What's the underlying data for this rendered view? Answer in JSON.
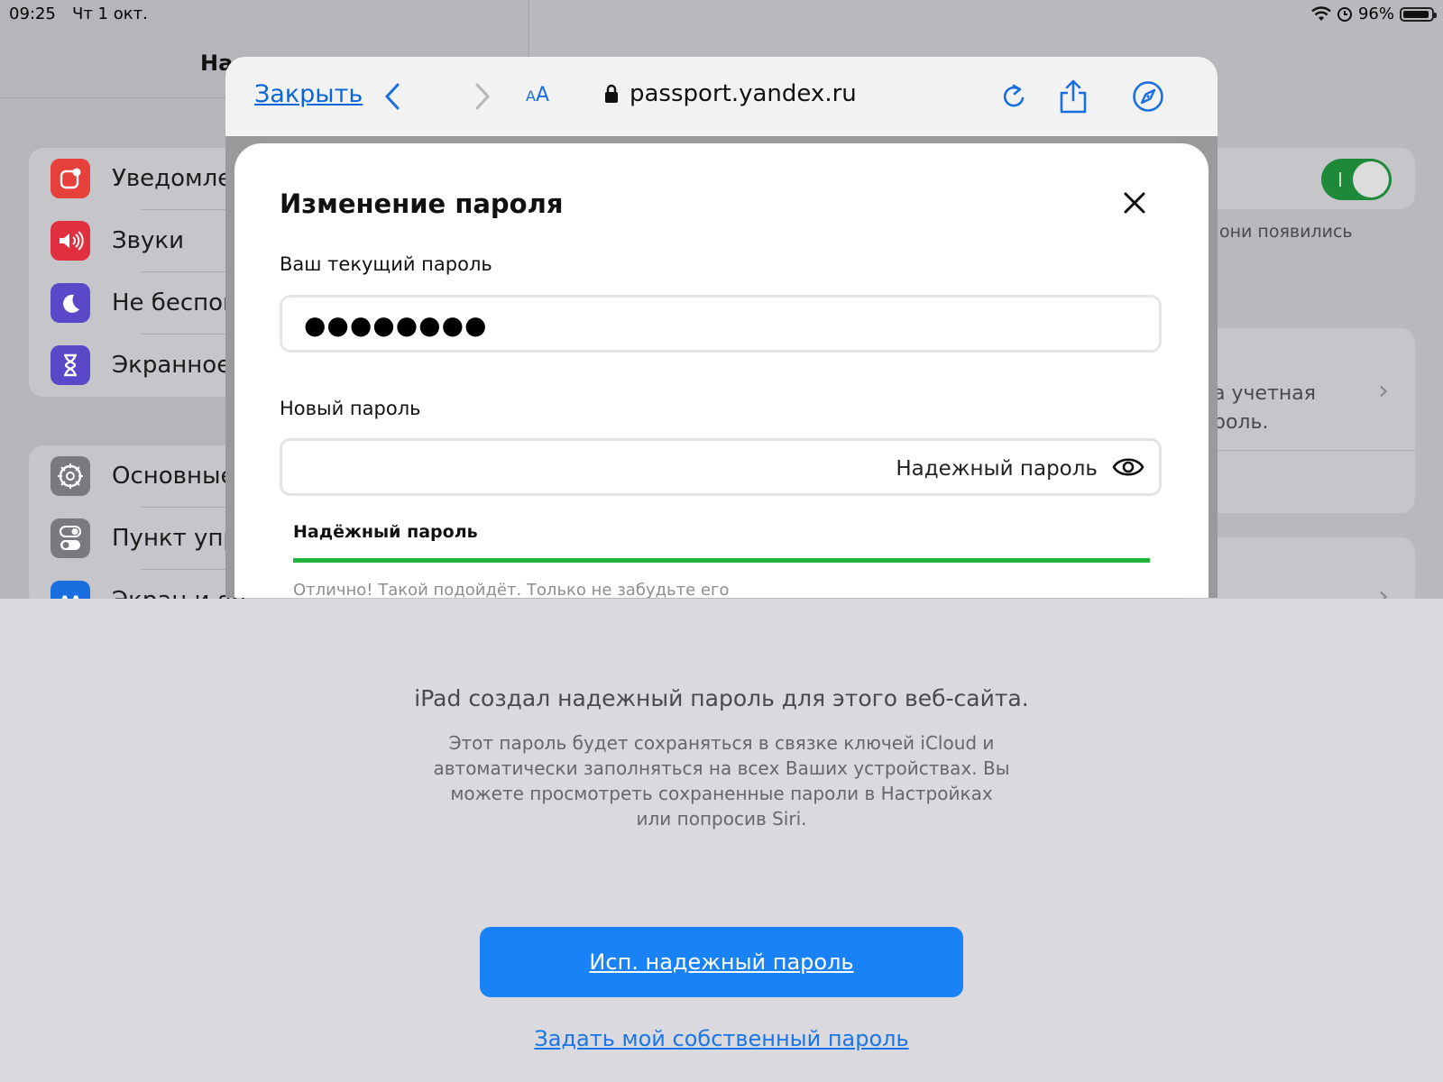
{
  "status_bar": {
    "time": "09:25",
    "date": "Чт 1 окт.",
    "battery": "96%"
  },
  "settings_bg": {
    "title": "На",
    "group1": [
      {
        "label": "Уведомле",
        "icon": "notifications-icon",
        "color": "#e5403a"
      },
      {
        "label": "Звуки",
        "icon": "sounds-icon",
        "color": "#e0303f"
      },
      {
        "label": "Не беспок",
        "icon": "moon-icon",
        "color": "#5948c8"
      },
      {
        "label": "Экранное",
        "icon": "hourglass-icon",
        "color": "#5948c8"
      }
    ],
    "group2": [
      {
        "label": "Основные",
        "icon": "gear-icon",
        "color": "#7a7a7e"
      },
      {
        "label": "Пункт упр",
        "icon": "control-center-icon",
        "color": "#7a7a7e"
      },
      {
        "label": "Экран и яр",
        "icon": "display-icon",
        "color": "#1a6fe0"
      }
    ],
    "right_text_1": "они появились",
    "right_text_2": "а учетная",
    "right_text_3": "роль.",
    "right_text_4": "а учетная"
  },
  "safari": {
    "close_label": "Закрыть",
    "aa_small": "A",
    "aa_big": "A",
    "url": "passport.yandex.ru"
  },
  "modal": {
    "title": "Изменение пароля",
    "current_label": "Ваш текущий пароль",
    "current_value": "●●●●●●●●",
    "new_label": "Новый пароль",
    "new_placeholder": "Надежный пароль",
    "strength_title": "Надёжный пароль",
    "strength_hint": "Отлично! Такой подойдёт. Только не забудьте его"
  },
  "password_panel": {
    "title": "iPad создал надежный пароль для этого веб-сайта.",
    "description": "Этот пароль будет сохраняться в связке ключей iCloud и автоматически заполняться на всех Ваших устройствах. Вы можете просмотреть сохраненные пароли в Настройках или попросив Siri.",
    "use_button": "Исп. надежный пароль",
    "own_link": "Задать мой собственный пароль"
  },
  "colors": {
    "accent": "#1a82f7",
    "link": "#0a66d6",
    "strength": "#20b33a"
  }
}
